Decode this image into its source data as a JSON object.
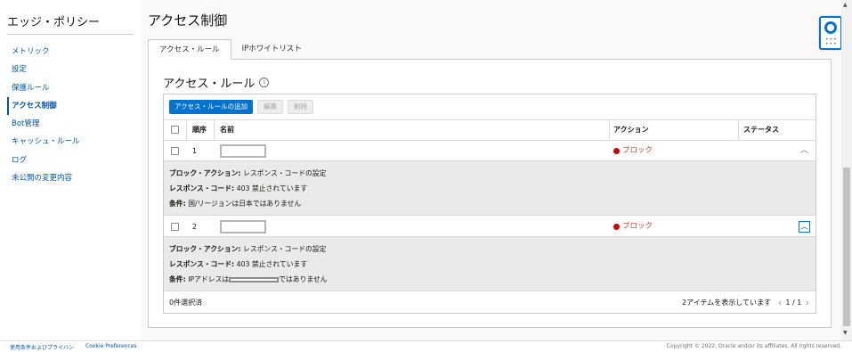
{
  "sidebar": {
    "title": "エッジ・ポリシー",
    "items": [
      {
        "label": "メトリック"
      },
      {
        "label": "設定"
      },
      {
        "label": "保護ルール"
      },
      {
        "label": "アクセス制御"
      },
      {
        "label": "Bot管理"
      },
      {
        "label": "キャッシュ・ルール"
      },
      {
        "label": "ログ"
      },
      {
        "label": "未公開の変更内容"
      }
    ],
    "active_index": 3
  },
  "main": {
    "page_title": "アクセス制御",
    "tabs": [
      {
        "label": "アクセス・ルール",
        "active": true
      },
      {
        "label": "IPホワイトリスト",
        "active": false
      }
    ],
    "section_title": "アクセス・ルール",
    "info_icon": "i",
    "toolbar": {
      "add_label": "アクセス・ルールの追加",
      "edit_label": "編集",
      "delete_label": "削除"
    },
    "columns": {
      "order": "順序",
      "name": "名前",
      "action": "アクション",
      "status": "ステータス"
    },
    "rows": [
      {
        "order": "1",
        "action": "ブロック",
        "detail": {
          "block_action_label": "ブロック・アクション:",
          "block_action_value": " レスポンス・コードの設定",
          "response_code_label": "レスポンス・コード:",
          "response_code_value": " 403 禁止されています",
          "condition_label": "条件:",
          "condition_value": " 国/リージョンは日本ではありません"
        }
      },
      {
        "order": "2",
        "action": "ブロック",
        "detail": {
          "block_action_label": "ブロック・アクション:",
          "block_action_value": " レスポンス・コードの設定",
          "response_code_label": "レスポンス・コード:",
          "response_code_value": " 403 禁止されています",
          "condition_label": "条件:",
          "condition_prefix": " IPアドレスは",
          "condition_suffix": "ではありません"
        }
      }
    ],
    "footer": {
      "selected": "0件選択済",
      "items_shown": "2アイテムを表示しています",
      "page": "1 / 1"
    }
  },
  "colors": {
    "link": "#0055a5",
    "primary": "#0572ce",
    "block": "#c74634"
  },
  "page_footer": {
    "terms": "使用条件およびプライバシ",
    "cookies": "Cookie Preferences",
    "copyright": "Copyright © 2022, Oracle and/or its affiliates. All rights reserved."
  }
}
